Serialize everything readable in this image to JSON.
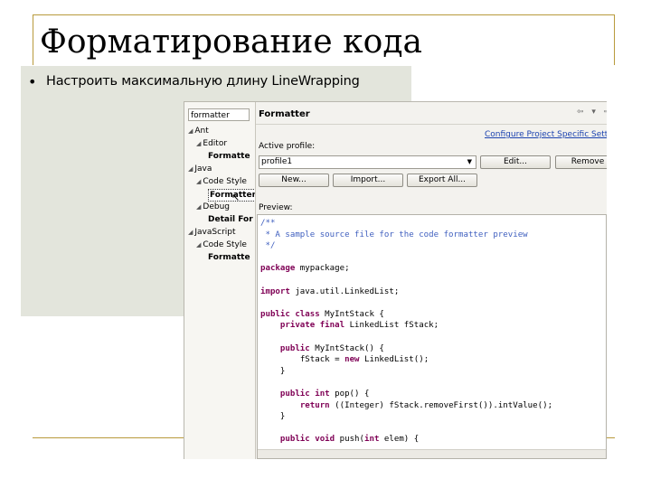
{
  "slide": {
    "title": "Форматирование кода",
    "bullet_marker": "•",
    "bullet": "Настроить максимальную длину LineWrapping"
  },
  "window": {
    "filter_value": "formatter",
    "tree": [
      {
        "label": "Ant",
        "twisty": "◢",
        "bold": false
      },
      {
        "label": "Editor",
        "twisty": "◢",
        "bold": false
      },
      {
        "label": "Formatte",
        "twisty": "",
        "bold": true
      },
      {
        "label": "Java",
        "twisty": "◢",
        "bold": false
      },
      {
        "label": "Code Style",
        "twisty": "◢",
        "bold": false
      },
      {
        "label": "Formatter",
        "twisty": "",
        "bold": true,
        "selected": true
      },
      {
        "label": "Debug",
        "twisty": "◢",
        "bold": false
      },
      {
        "label": "Detail For",
        "twisty": "",
        "bold": true
      },
      {
        "label": "JavaScript",
        "twisty": "◢",
        "bold": false
      },
      {
        "label": "Code Style",
        "twisty": "◢",
        "bold": false
      },
      {
        "label": "Formatte",
        "twisty": "",
        "bold": true
      }
    ],
    "page_title": "Formatter",
    "toolbar_icons": "⇦ ▾ ⇨ ▾",
    "config_link": "Configure Project Specific Settings...",
    "active_profile_label": "Active profile:",
    "profile_value": "profile1",
    "buttons": {
      "edit": "Edit...",
      "remove": "Remove",
      "new": "New...",
      "import": "Import...",
      "export": "Export All..."
    },
    "preview_label": "Preview:",
    "code": [
      {
        "text": "/**",
        "style": "comment"
      },
      {
        "text": " * A sample source file for the code formatter preview",
        "style": "comment"
      },
      {
        "text": " */",
        "style": "comment"
      },
      {
        "text": "",
        "style": "plain"
      },
      {
        "kw": "package",
        "rest": " mypackage;"
      },
      {
        "text": "",
        "style": "plain"
      },
      {
        "kw": "import",
        "rest": " java.util.LinkedList;"
      },
      {
        "text": "",
        "style": "plain"
      },
      {
        "kw": "public class",
        "rest": " MyIntStack {"
      },
      {
        "indent": "    ",
        "kw": "private final",
        "rest": " LinkedList fStack;"
      },
      {
        "text": "",
        "style": "plain"
      },
      {
        "indent": "    ",
        "kw": "public",
        "rest": " MyIntStack() {"
      },
      {
        "indent": "        ",
        "text2": "fStack = ",
        "kw": "new",
        "rest": " LinkedList();"
      },
      {
        "text": "    }",
        "style": "plain"
      },
      {
        "text": "",
        "style": "plain"
      },
      {
        "indent": "    ",
        "kw": "public int",
        "rest": " pop() {"
      },
      {
        "indent": "        ",
        "kw": "return",
        "rest": " ((Integer) fStack.removeFirst()).intValue();"
      },
      {
        "text": "    }",
        "style": "plain"
      },
      {
        "text": "",
        "style": "plain"
      },
      {
        "indent": "    ",
        "kw": "public void",
        "rest": " push(",
        "kw2": "int",
        "rest2": " elem) {"
      }
    ]
  }
}
